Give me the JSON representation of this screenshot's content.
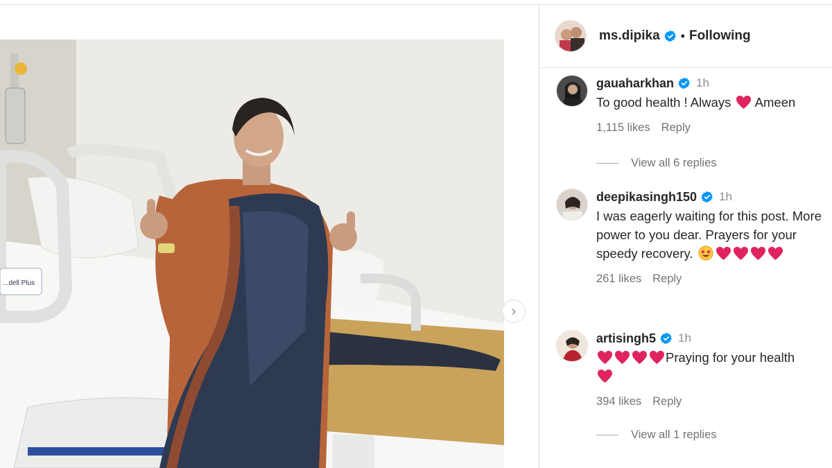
{
  "post": {
    "username": "ms.dipika",
    "separator": "•",
    "follow_status": "Following"
  },
  "comments": [
    {
      "username": "gauaharkhan",
      "time": "1h",
      "text_before": "To good health ! Always ",
      "text_after": " Ameen",
      "likes": "1,115 likes",
      "reply_label": "Reply",
      "view_replies": "View all 6 replies"
    },
    {
      "username": "deepikasingh150",
      "time": "1h",
      "text": "I was eagerly waiting for this post. More power to you dear. Prayers for your speedy recovery.",
      "likes": "261 likes",
      "reply_label": "Reply"
    },
    {
      "username": "artisingh5",
      "time": "1h",
      "text": "Praying for your health",
      "likes": "394 likes",
      "reply_label": "Reply",
      "view_replies": "View all 1 replies"
    }
  ],
  "photo": {
    "bed_label": "...dell Plus",
    "next_icon": "chevron-right-icon"
  },
  "colors": {
    "verified": "#0095f6",
    "heart": "#e0245e",
    "secondary_text": "#737373"
  }
}
